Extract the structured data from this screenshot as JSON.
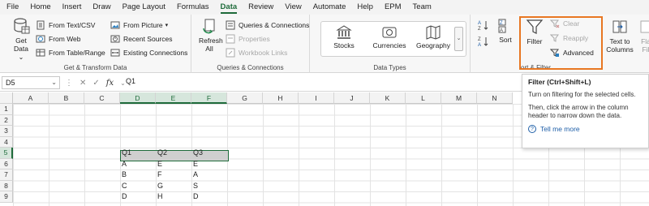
{
  "menu": {
    "tabs": [
      "File",
      "Home",
      "Insert",
      "Draw",
      "Page Layout",
      "Formulas",
      "Data",
      "Review",
      "View",
      "Automate",
      "Help",
      "EPM",
      "Team"
    ],
    "active_tab": "Data"
  },
  "ribbon": {
    "get_transform": {
      "label": "Get & Transform Data",
      "get_data": "Get Data",
      "get_data_caret": "⌄",
      "from_text_csv": "From Text/CSV",
      "from_web": "From Web",
      "from_table_range": "From Table/Range",
      "from_picture": "From Picture",
      "recent_sources": "Recent Sources",
      "existing_connections": "Existing Connections"
    },
    "queries_connections": {
      "label": "Queries & Connections",
      "refresh_all": "Refresh All",
      "queries_and_connections": "Queries & Connections",
      "properties": "Properties",
      "workbook_links": "Workbook Links"
    },
    "data_types": {
      "label": "Data Types",
      "stocks": "Stocks",
      "currencies": "Currencies",
      "geography": "Geography"
    },
    "sort_filter": {
      "label": "ort & Filter",
      "sort": "Sort",
      "filter": "Filter",
      "clear": "Clear",
      "reapply": "Reapply",
      "advanced": "Advanced"
    },
    "data_tools": {
      "text_to_columns": "Text to Columns",
      "flash_fill": "Fla Fil"
    }
  },
  "formula_bar": {
    "name_box": "D5",
    "value": "Q1"
  },
  "grid": {
    "columns": [
      "A",
      "B",
      "C",
      "D",
      "E",
      "F",
      "G",
      "H",
      "I",
      "J",
      "K",
      "L",
      "M",
      "N"
    ],
    "rows": [
      "1",
      "2",
      "3",
      "4",
      "5",
      "6",
      "7",
      "8",
      "9"
    ],
    "selected_columns": [
      "D",
      "E",
      "F"
    ],
    "selected_row": "5",
    "cells": {
      "D5": "Q1",
      "E5": "Q2",
      "F5": "Q3",
      "D6": "A",
      "E6": "E",
      "F6": "E",
      "D7": "B",
      "E7": "F",
      "F7": "A",
      "D8": "C",
      "E8": "G",
      "F8": "S",
      "D9": "D",
      "E9": "H",
      "F9": "D"
    }
  },
  "tooltip": {
    "title": "Filter (Ctrl+Shift+L)",
    "para1": "Turn on filtering for the selected cells.",
    "para2": "Then, click the arrow in the column header to narrow down the data.",
    "link": "Tell me more"
  },
  "colors": {
    "accent_green": "#1e6b3a",
    "highlight_orange": "#e87722",
    "link_blue": "#1f5fa8"
  }
}
